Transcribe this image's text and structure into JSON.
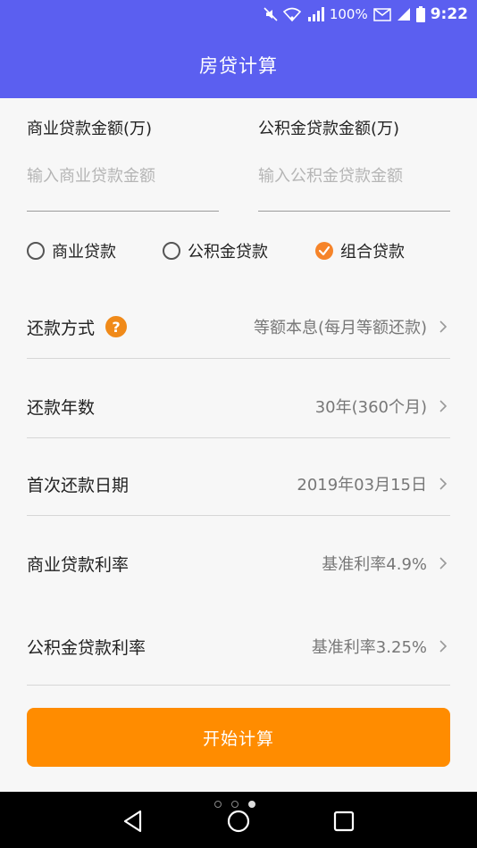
{
  "status_bar": {
    "battery_pct": "100%",
    "time": "9:22"
  },
  "app_bar": {
    "title": "房贷计算"
  },
  "amounts": {
    "commercial": {
      "label": "商业贷款金额(万)",
      "placeholder": "输入商业贷款金额",
      "value": ""
    },
    "fund": {
      "label": "公积金贷款金额(万)",
      "placeholder": "输入公积金贷款金额",
      "value": ""
    }
  },
  "loan_type": {
    "options": [
      {
        "label": "商业贷款",
        "checked": false
      },
      {
        "label": "公积金贷款",
        "checked": false
      },
      {
        "label": "组合贷款",
        "checked": true
      }
    ]
  },
  "rows": {
    "repay_method": {
      "label": "还款方式",
      "value": "等额本息(每月等额还款)"
    },
    "repay_years": {
      "label": "还款年数",
      "value": "30年(360个月)"
    },
    "first_date": {
      "label": "首次还款日期",
      "value": "2019年03月15日"
    },
    "commercial_rate": {
      "label": "商业贷款利率",
      "value": "基准利率4.9%"
    },
    "fund_rate": {
      "label": "公积金贷款利率",
      "value": "基准利率3.25%"
    }
  },
  "help_icon_glyph": "?",
  "calc_button": {
    "label": "开始计算"
  },
  "colors": {
    "primary": "#5b5ff0",
    "accent": "#ff8c00",
    "check": "#f6842a"
  },
  "nav": {
    "page_dots": 3,
    "active_dot": 3
  }
}
